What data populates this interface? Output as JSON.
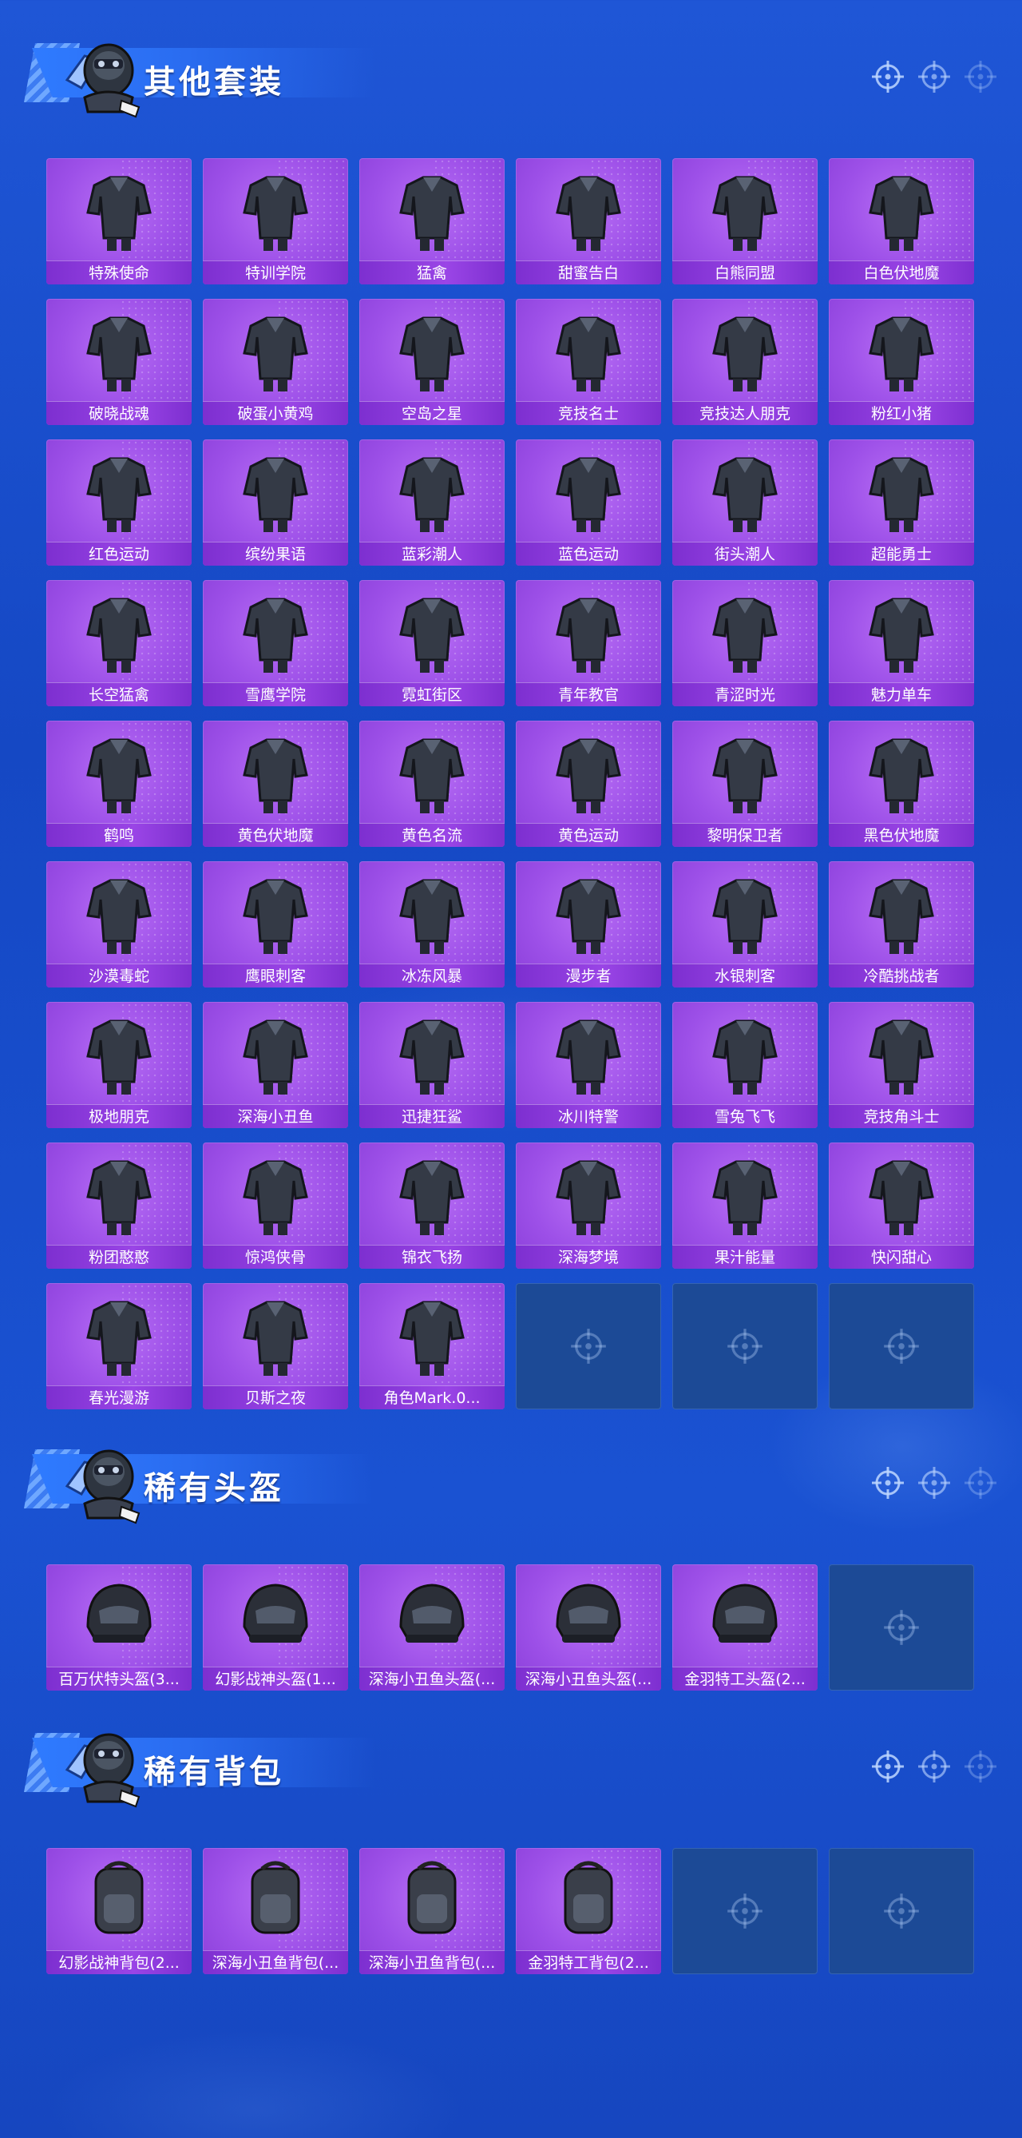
{
  "colors": {
    "background": "#1a4fcf",
    "card_purple": "#9d50e8",
    "card_label": "#8a3fd9",
    "empty_slot": "#1c4a96",
    "title_text": "#ffffff"
  },
  "sections": [
    {
      "title": "其他套装",
      "icon": "crosshair-icon",
      "items": [
        "特殊使命",
        "特训学院",
        "猛禽",
        "甜蜜告白",
        "白熊同盟",
        "白色伏地魔",
        "破晓战魂",
        "破蛋小黄鸡",
        "空岛之星",
        "竞技名士",
        "竞技达人朋克",
        "粉红小猪",
        "红色运动",
        "缤纷果语",
        "蓝彩潮人",
        "蓝色运动",
        "街头潮人",
        "超能勇士",
        "长空猛禽",
        "雪鹰学院",
        "霓虹街区",
        "青年教官",
        "青涩时光",
        "魅力单车",
        "鹤鸣",
        "黄色伏地魔",
        "黄色名流",
        "黄色运动",
        "黎明保卫者",
        "黑色伏地魔",
        "沙漠毒蛇",
        "鹰眼刺客",
        "冰冻风暴",
        "漫步者",
        "水银刺客",
        "冷酷挑战者",
        "极地朋克",
        "深海小丑鱼",
        "迅捷狂鲨",
        "冰川特警",
        "雪兔飞飞",
        "竞技角斗士",
        "粉团憨憨",
        "惊鸿侠骨",
        "锦衣飞扬",
        "深海梦境",
        "果汁能量",
        "快闪甜心",
        "春光漫游",
        "贝斯之夜",
        "角色Mark.0..."
      ],
      "empty_slots": 3
    },
    {
      "title": "稀有头盔",
      "icon": "crosshair-icon",
      "items": [
        "百万伏特头盔(3...",
        "幻影战神头盔(1...",
        "深海小丑鱼头盔(...",
        "深海小丑鱼头盔(...",
        "金羽特工头盔(2..."
      ],
      "empty_slots": 1
    },
    {
      "title": "稀有背包",
      "icon": "crosshair-icon",
      "items": [
        "幻影战神背包(2...",
        "深海小丑鱼背包(...",
        "深海小丑鱼背包(...",
        "金羽特工背包(2..."
      ],
      "empty_slots": 2
    }
  ]
}
